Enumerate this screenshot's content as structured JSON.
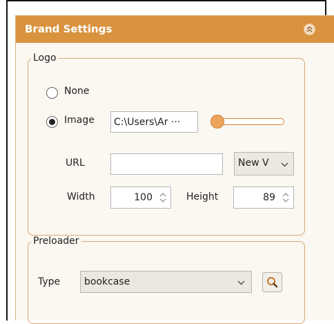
{
  "panel": {
    "title": "Brand Settings",
    "collapse_icon": "double-chevron-up-icon",
    "accent_color": "#d9923e"
  },
  "logo": {
    "legend": "Logo",
    "options": [
      {
        "label": "None",
        "selected": false
      },
      {
        "label": "Image",
        "selected": true
      }
    ],
    "image_path": "C:\\Users\\Ar ···",
    "size_slider_value": 0.05,
    "url_label": "URL",
    "url_value": "",
    "target_value": "New V",
    "width_label": "Width",
    "width_value": "100",
    "height_label": "Height",
    "height_value": "89"
  },
  "preloader": {
    "legend": "Preloader",
    "type_label": "Type",
    "type_value": "bookcase",
    "search_icon": "search-icon"
  }
}
